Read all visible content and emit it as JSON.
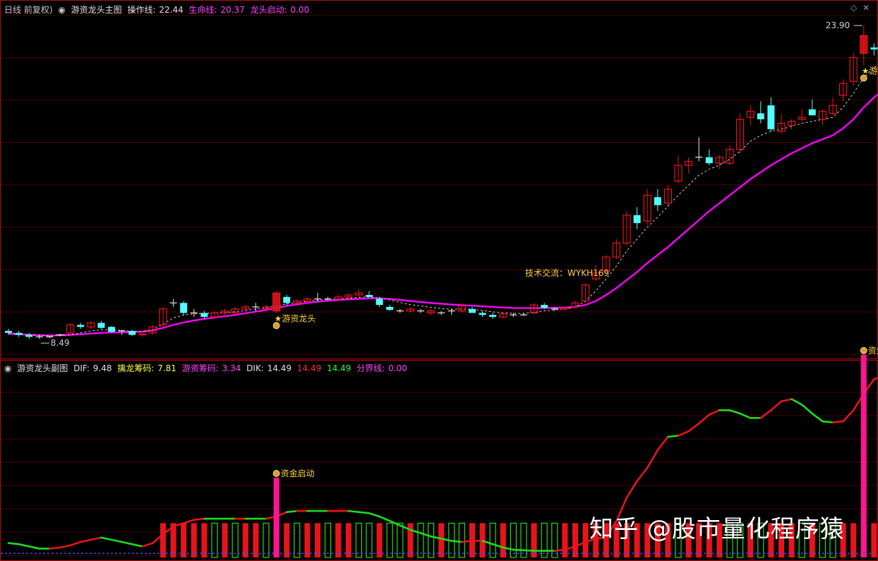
{
  "main_header": {
    "prefix": "日线 前复权)",
    "title": "游资龙头主图",
    "op_label": "操作线:",
    "op_value": "22.44",
    "life_label": "生命线:",
    "life_value": "20.37",
    "dragon_label": "龙头启动:",
    "dragon_value": "0.00"
  },
  "sub_header": {
    "title": "游资龙头副图",
    "dif_label": "DIF:",
    "dif_value": "9.48",
    "qin_label": "擒龙筹码:",
    "qin_value": "7.81",
    "you_label": "游资筹码:",
    "you_value": "3.34",
    "dik_label": "DIK:",
    "dik_value": "14.49",
    "red_value": "14.49",
    "green_value": "14.49",
    "fen_label": "分界线:",
    "fen_value": "0.00"
  },
  "annotations": {
    "high": "23.90",
    "low": "8.49",
    "contact": "技术交流：WYKH169",
    "signal_main": "游资龙头",
    "signal_sub": "资金启动"
  },
  "watermark": "知乎 @股市量化程序猿",
  "colors": {
    "up": "#e8141c",
    "down": "#54ffff",
    "life": "#ff00ff",
    "op": "#cccccc",
    "dif_up": "#e8141c",
    "dif_down": "#1fdc1f",
    "grid": "#4a0000",
    "frame": "#b01010",
    "hdr_white": "#e0e0e0",
    "hdr_pink": "#ff40ff",
    "hdr_yellow": "#ffff40",
    "signal": "#ffd040",
    "sig_bar": "#ff1493"
  },
  "chart_data": [
    {
      "type": "candlestick",
      "title": "游资龙头主图",
      "ylim": [
        7.6,
        24.5
      ],
      "high_label": 23.9,
      "low_label": 8.49,
      "candles": [
        [
          8.7,
          8.8,
          8.5,
          8.6
        ],
        [
          8.6,
          8.7,
          8.4,
          8.5
        ],
        [
          8.5,
          8.6,
          8.3,
          8.4
        ],
        [
          8.4,
          8.5,
          8.3,
          8.4
        ],
        [
          8.4,
          8.45,
          8.35,
          8.4
        ],
        [
          8.5,
          8.55,
          8.45,
          8.5
        ],
        [
          8.6,
          9.1,
          8.5,
          9.0
        ],
        [
          9.0,
          9.1,
          8.8,
          8.9
        ],
        [
          8.9,
          9.2,
          8.8,
          9.1
        ],
        [
          9.1,
          9.2,
          8.8,
          8.85
        ],
        [
          8.9,
          8.95,
          8.6,
          8.65
        ],
        [
          8.7,
          8.75,
          8.5,
          8.7
        ],
        [
          8.7,
          8.75,
          8.45,
          8.5
        ],
        [
          8.5,
          8.6,
          8.4,
          8.55
        ],
        [
          8.6,
          9.0,
          8.5,
          8.9
        ],
        [
          9.0,
          9.9,
          8.9,
          9.8
        ],
        [
          10.1,
          10.3,
          9.9,
          10.1
        ],
        [
          10.1,
          10.2,
          9.5,
          9.6
        ],
        [
          9.6,
          9.8,
          9.4,
          9.6
        ],
        [
          9.6,
          9.7,
          9.3,
          9.4
        ],
        [
          9.4,
          9.7,
          9.3,
          9.6
        ],
        [
          9.6,
          9.8,
          9.4,
          9.7
        ],
        [
          9.6,
          9.9,
          9.5,
          9.8
        ],
        [
          9.8,
          10.0,
          9.6,
          9.9
        ],
        [
          9.9,
          10.1,
          9.7,
          9.9
        ],
        [
          9.8,
          10.0,
          9.6,
          9.9
        ],
        [
          9.7,
          10.7,
          9.6,
          10.6
        ],
        [
          10.4,
          10.5,
          10.0,
          10.1
        ],
        [
          10.1,
          10.3,
          10.0,
          10.2
        ],
        [
          10.2,
          10.4,
          10.1,
          10.3
        ],
        [
          10.3,
          10.6,
          10.2,
          10.3
        ],
        [
          10.3,
          10.4,
          10.2,
          10.3
        ],
        [
          10.3,
          10.5,
          10.2,
          10.4
        ],
        [
          10.4,
          10.6,
          10.3,
          10.5
        ],
        [
          10.5,
          10.8,
          10.4,
          10.6
        ],
        [
          10.5,
          10.7,
          10.4,
          10.4
        ],
        [
          10.3,
          10.4,
          9.9,
          10.0
        ],
        [
          9.9,
          10.0,
          9.7,
          9.75
        ],
        [
          9.7,
          9.8,
          9.6,
          9.7
        ],
        [
          9.7,
          9.9,
          9.6,
          9.8
        ],
        [
          9.7,
          9.8,
          9.6,
          9.7
        ],
        [
          9.6,
          9.8,
          9.5,
          9.7
        ],
        [
          9.6,
          9.7,
          9.5,
          9.6
        ],
        [
          9.7,
          9.8,
          9.5,
          9.7
        ],
        [
          9.7,
          10.1,
          9.6,
          9.95
        ],
        [
          9.8,
          9.9,
          9.6,
          9.6
        ],
        [
          9.6,
          9.7,
          9.4,
          9.5
        ],
        [
          9.5,
          9.6,
          9.3,
          9.4
        ],
        [
          9.4,
          9.6,
          9.3,
          9.55
        ],
        [
          9.5,
          9.6,
          9.4,
          9.5
        ],
        [
          9.5,
          9.6,
          9.45,
          9.5
        ],
        [
          9.6,
          10.1,
          9.5,
          10.0
        ],
        [
          10.0,
          10.1,
          9.8,
          9.85
        ],
        [
          9.8,
          9.9,
          9.7,
          9.8
        ],
        [
          9.8,
          9.9,
          9.7,
          9.85
        ],
        [
          9.9,
          10.2,
          9.8,
          10.1
        ],
        [
          10.2,
          11.1,
          10.1,
          11.0
        ],
        [
          11.3,
          12.0,
          11.2,
          11.6
        ],
        [
          11.7,
          12.5,
          11.6,
          12.4
        ],
        [
          12.4,
          13.3,
          12.3,
          13.1
        ],
        [
          13.1,
          14.7,
          13.0,
          14.5
        ],
        [
          14.5,
          14.9,
          13.8,
          14.1
        ],
        [
          14.2,
          15.8,
          14.0,
          15.5
        ],
        [
          15.4,
          15.8,
          14.7,
          15.0
        ],
        [
          15.1,
          16.0,
          15.0,
          15.8
        ],
        [
          16.2,
          17.5,
          16.1,
          17.0
        ],
        [
          17.0,
          17.4,
          16.6,
          17.2
        ],
        [
          17.4,
          18.4,
          17.2,
          17.4
        ],
        [
          17.4,
          17.8,
          17.0,
          17.1
        ],
        [
          17.1,
          17.5,
          16.8,
          17.4
        ],
        [
          17.1,
          18.0,
          17.0,
          17.8
        ],
        [
          17.8,
          19.6,
          17.6,
          19.3
        ],
        [
          19.4,
          20.0,
          19.0,
          19.7
        ],
        [
          19.6,
          20.2,
          19.1,
          19.3
        ],
        [
          20.0,
          20.4,
          18.7,
          18.8
        ],
        [
          18.7,
          19.6,
          18.6,
          19.1
        ],
        [
          19.0,
          19.3,
          18.8,
          19.2
        ],
        [
          19.3,
          19.8,
          19.2,
          19.4
        ],
        [
          19.8,
          20.3,
          19.5,
          19.5
        ],
        [
          19.3,
          19.8,
          19.0,
          19.7
        ],
        [
          19.6,
          20.4,
          19.5,
          20.0
        ],
        [
          20.5,
          21.3,
          20.2,
          21.1
        ],
        [
          21.2,
          22.6,
          21.0,
          22.4
        ],
        [
          22.6,
          24.0,
          22.0,
          23.5
        ],
        [
          22.9,
          23.1,
          22.5,
          22.8
        ],
        [
          22.9,
          23.1,
          22.3,
          22.4
        ],
        [
          22.2,
          22.7,
          21.9,
          22.4
        ]
      ],
      "life_line": [
        8.55,
        8.53,
        8.5,
        8.48,
        8.47,
        8.48,
        8.5,
        8.53,
        8.57,
        8.6,
        8.62,
        8.63,
        8.64,
        8.66,
        8.72,
        8.85,
        9.0,
        9.12,
        9.22,
        9.3,
        9.37,
        9.43,
        9.5,
        9.58,
        9.66,
        9.75,
        9.85,
        9.95,
        10.03,
        10.1,
        10.16,
        10.21,
        10.25,
        10.28,
        10.31,
        10.33,
        10.33,
        10.3,
        10.25,
        10.2,
        10.15,
        10.1,
        10.06,
        10.02,
        9.99,
        9.96,
        9.93,
        9.9,
        9.87,
        9.85,
        9.84,
        9.84,
        9.85,
        9.86,
        9.87,
        9.9,
        10.0,
        10.2,
        10.5,
        10.85,
        11.25,
        11.65,
        12.1,
        12.5,
        12.9,
        13.35,
        13.8,
        14.25,
        14.7,
        15.1,
        15.5,
        15.9,
        16.3,
        16.65,
        17.0,
        17.3,
        17.6,
        17.85,
        18.1,
        18.3,
        18.5,
        18.85,
        19.3,
        19.9,
        20.4,
        20.8,
        21.1
      ],
      "op_line": [
        8.6,
        8.55,
        8.5,
        8.48,
        8.46,
        8.46,
        8.5,
        8.6,
        8.7,
        8.75,
        8.75,
        8.72,
        8.68,
        8.67,
        8.75,
        9.05,
        9.35,
        9.5,
        9.55,
        9.58,
        9.6,
        9.62,
        9.66,
        9.72,
        9.8,
        9.85,
        9.95,
        10.05,
        10.12,
        10.18,
        10.24,
        10.28,
        10.3,
        10.33,
        10.38,
        10.4,
        10.35,
        10.25,
        10.12,
        10.02,
        9.95,
        9.88,
        9.82,
        9.78,
        9.8,
        9.78,
        9.72,
        9.65,
        9.6,
        9.58,
        9.57,
        9.63,
        9.7,
        9.75,
        9.8,
        9.9,
        10.2,
        10.7,
        11.3,
        11.95,
        12.7,
        13.3,
        13.9,
        14.4,
        14.95,
        15.5,
        16.0,
        16.5,
        16.8,
        17.0,
        17.3,
        17.7,
        18.2,
        18.5,
        18.7,
        18.8,
        18.95,
        19.1,
        19.2,
        19.3,
        19.4,
        19.9,
        20.6,
        21.4,
        21.9,
        22.2,
        22.44
      ],
      "signals": [
        26,
        83
      ]
    },
    {
      "type": "line",
      "title": "游资龙头副图",
      "ylim": [
        -0.5,
        16.2
      ],
      "dif": [
        0.8,
        0.7,
        0.5,
        0.3,
        0.3,
        0.4,
        0.6,
        0.9,
        1.1,
        1.3,
        1.1,
        0.9,
        0.7,
        0.5,
        0.8,
        1.6,
        2.3,
        2.6,
        2.9,
        3.0,
        3.0,
        3.0,
        3.0,
        3.0,
        3.0,
        3.0,
        3.2,
        3.6,
        3.7,
        3.7,
        3.7,
        3.7,
        3.7,
        3.7,
        3.6,
        3.5,
        3.2,
        2.8,
        2.4,
        2.0,
        1.7,
        1.4,
        1.2,
        1.0,
        0.9,
        1.0,
        1.0,
        0.7,
        0.4,
        0.2,
        0.15,
        0.1,
        0.1,
        0.1,
        0.2,
        0.5,
        0.9,
        1.2,
        1.3,
        2.8,
        4.9,
        6.4,
        7.6,
        9.2,
        10.4,
        10.5,
        10.9,
        11.6,
        12.4,
        12.8,
        12.8,
        12.5,
        12.1,
        12.1,
        12.8,
        13.6,
        13.8,
        13.3,
        12.5,
        11.8,
        11.7,
        11.8,
        12.8,
        14.3,
        15.6,
        15.9,
        15.6
      ],
      "dif_trend": [
        0,
        0,
        0,
        0,
        0,
        1,
        1,
        1,
        1,
        1,
        0,
        0,
        0,
        0,
        1,
        1,
        1,
        1,
        1,
        1,
        0,
        0,
        0,
        1,
        0,
        0,
        1,
        1,
        0,
        1,
        0,
        0,
        1,
        1,
        0,
        0,
        0,
        0,
        0,
        0,
        0,
        0,
        0,
        0,
        0,
        1,
        1,
        0,
        0,
        0,
        0,
        0,
        0,
        0,
        1,
        1,
        1,
        1,
        1,
        1,
        1,
        1,
        1,
        1,
        1,
        0,
        1,
        1,
        1,
        1,
        0,
        0,
        0,
        0,
        1,
        1,
        1,
        0,
        0,
        0,
        0,
        1,
        1,
        1,
        1,
        1,
        0
      ],
      "bars_from": 15,
      "signals": [
        26,
        83
      ]
    }
  ]
}
